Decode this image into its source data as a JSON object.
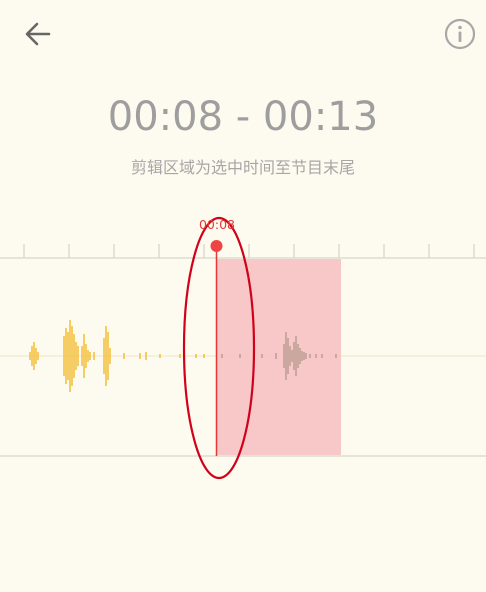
{
  "header": {
    "back_icon": "arrow-left-icon",
    "info_icon": "info-circle-icon"
  },
  "selection": {
    "time_range": "00:08 - 00:13",
    "hint": "剪辑区域为选中时间至节目末尾"
  },
  "playhead": {
    "time": "00:08"
  },
  "colors": {
    "background": "#fdfbef",
    "waveform": "#f5c242",
    "selection_fill": "#f8c4c4",
    "playhead": "#e53935",
    "annotation": "#d0021b",
    "muted_text": "#9e9e9e"
  }
}
